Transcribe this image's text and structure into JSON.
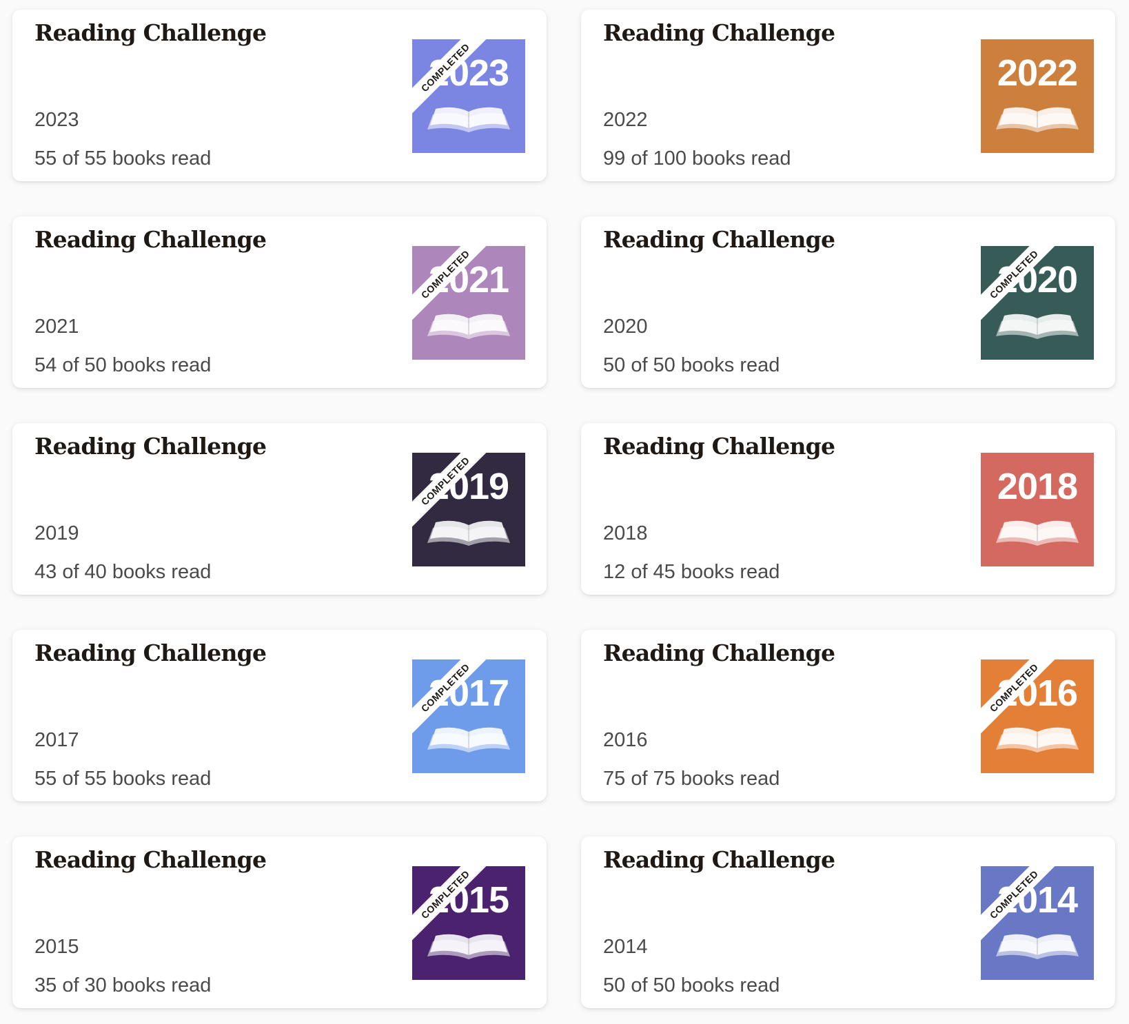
{
  "cards": [
    {
      "title": "Reading Challenge",
      "year": "2023",
      "progress": "55 of 55 books read",
      "badge": {
        "year": "2023",
        "color": "#7b85e2",
        "book_icon": "open-book-icon",
        "ribbon": "COMPLETED"
      }
    },
    {
      "title": "Reading Challenge",
      "year": "2022",
      "progress": "99 of 100 books read",
      "badge": {
        "year": "2022",
        "color": "#cd7f3d",
        "book_icon": "open-book-icon",
        "ribbon": ""
      }
    },
    {
      "title": "Reading Challenge",
      "year": "2021",
      "progress": "54 of 50 books read",
      "badge": {
        "year": "2021",
        "color": "#ad86bb",
        "book_icon": "open-book-icon",
        "ribbon": "COMPLETED"
      }
    },
    {
      "title": "Reading Challenge",
      "year": "2020",
      "progress": "50 of 50 books read",
      "badge": {
        "year": "2020",
        "color": "#375c58",
        "book_icon": "open-book-icon",
        "ribbon": "COMPLETED"
      }
    },
    {
      "title": "Reading Challenge",
      "year": "2019",
      "progress": "43 of 40 books read",
      "badge": {
        "year": "2019",
        "color": "#322a41",
        "book_icon": "open-book-icon",
        "ribbon": "COMPLETED"
      }
    },
    {
      "title": "Reading Challenge",
      "year": "2018",
      "progress": "12 of 45 books read",
      "badge": {
        "year": "2018",
        "color": "#d4695f",
        "book_icon": "open-book-icon",
        "ribbon": ""
      }
    },
    {
      "title": "Reading Challenge",
      "year": "2017",
      "progress": "55 of 55 books read",
      "badge": {
        "year": "2017",
        "color": "#6e9ceb",
        "book_icon": "open-book-icon",
        "ribbon": "COMPLETED"
      }
    },
    {
      "title": "Reading Challenge",
      "year": "2016",
      "progress": "75 of 75 books read",
      "badge": {
        "year": "2016",
        "color": "#e47f37",
        "book_icon": "open-book-icon",
        "ribbon": "COMPLETED"
      }
    },
    {
      "title": "Reading Challenge",
      "year": "2015",
      "progress": "35 of 30 books read",
      "badge": {
        "year": "2015",
        "color": "#4a226d",
        "book_icon": "open-book-icon",
        "ribbon": "COMPLETED"
      }
    },
    {
      "title": "Reading Challenge",
      "year": "2014",
      "progress": "50 of 50 books read",
      "badge": {
        "year": "2014",
        "color": "#6878c4",
        "book_icon": "open-book-icon",
        "ribbon": "COMPLETED"
      }
    }
  ]
}
